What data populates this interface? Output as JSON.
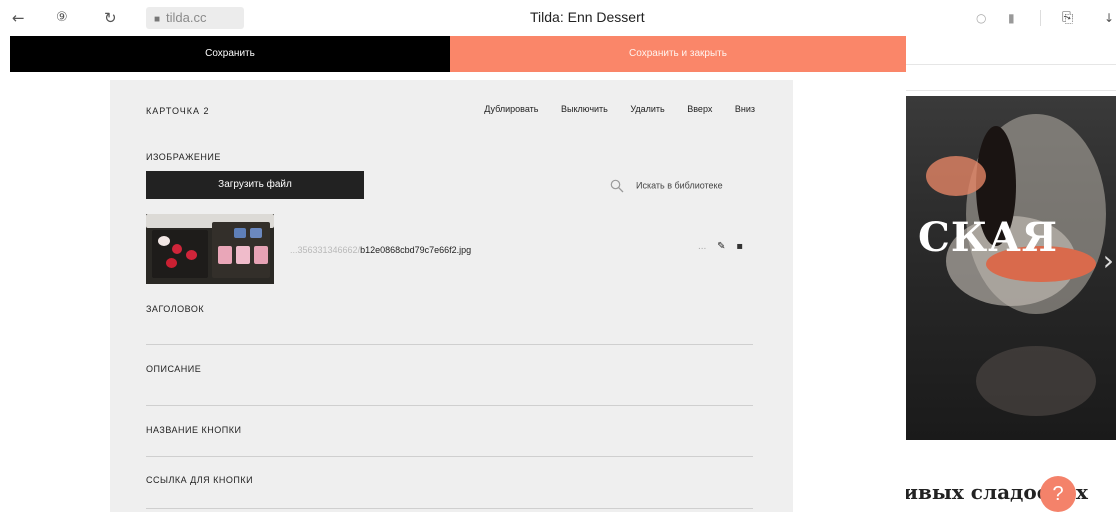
{
  "browser": {
    "url": "tilda.cc",
    "tab_title": "Tilda: Enn Dessert"
  },
  "savebar": {
    "save_label": "Сохранить",
    "save_close_label": "Сохранить и закрыть"
  },
  "card": {
    "title": "КАРТОЧКА 2",
    "actions": [
      "Дублировать",
      "Выключить",
      "Удалить",
      "Вверх",
      "Вниз"
    ]
  },
  "image_section": {
    "label": "ИЗОБРАЖЕНИЕ",
    "upload_label": "Загрузить файл",
    "library_search_label": "Искать в библиотеке",
    "file_prefix": "...356331346662/",
    "file_name": "b12e0868cbd79c7e66f2.jpg",
    "file_tools_more": "..."
  },
  "fields": [
    {
      "label": "ЗАГОЛОВОК"
    },
    {
      "label": "ОПИСАНИЕ"
    },
    {
      "label": "НАЗВАНИЕ КНОПКИ"
    },
    {
      "label": "ССЫЛКА ДЛЯ КНОПКИ"
    }
  ],
  "preview": {
    "hero_word": "СКАЯ",
    "bottom_text": "асивых сладостях",
    "help_label": "?"
  },
  "colors": {
    "accent": "#fa8669",
    "dark_button": "#222222",
    "panel_bg": "#efefef"
  }
}
